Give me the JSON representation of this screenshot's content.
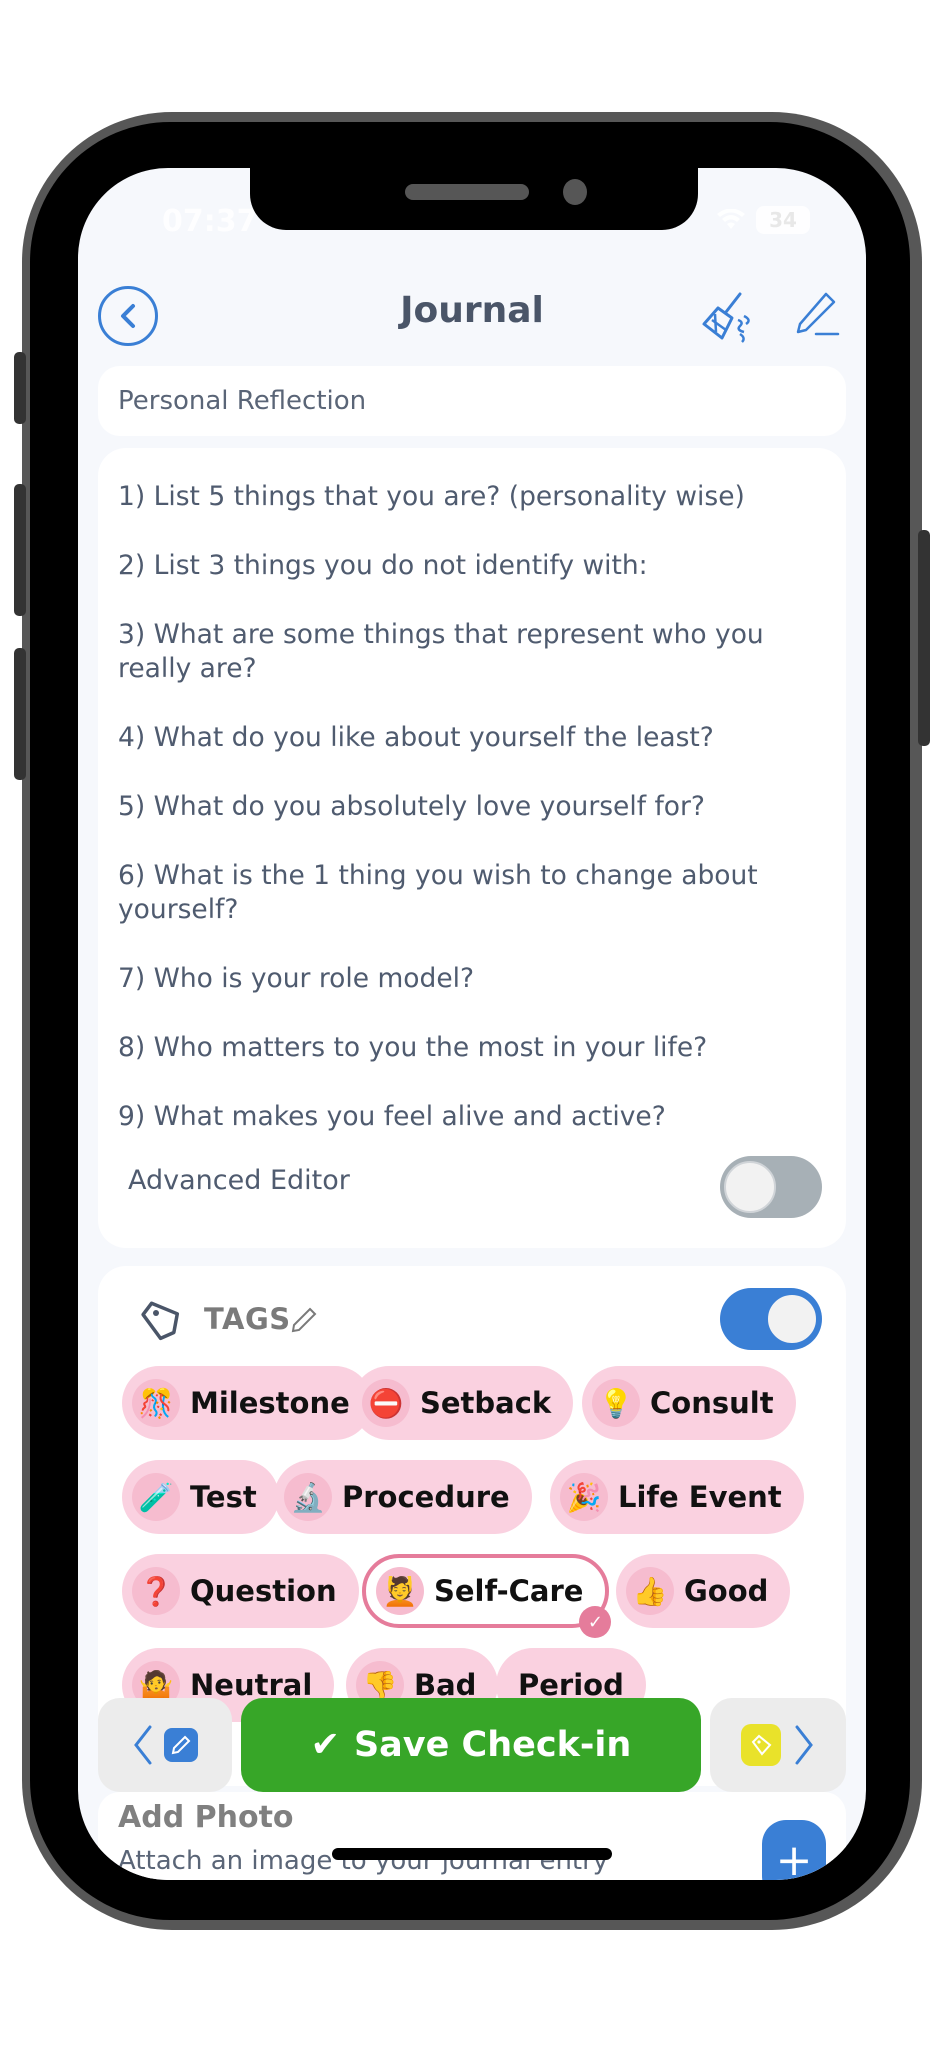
{
  "status_bar": {
    "time": "07:37",
    "battery": "34"
  },
  "header": {
    "title": "Journal"
  },
  "entry": {
    "title_value": "Personal Reflection"
  },
  "questions": [
    "1) List 5 things that you are? (personality wise)",
    "2) List 3 things you do not identify with:",
    "3) What are some things that represent who you really are?",
    "4) What do you like about yourself the least?",
    "5) What do you absolutely love yourself for?",
    "6) What is the 1 thing you wish to change about yourself?",
    "7) Who is your role model?",
    "8) Who matters to you the most in your life?",
    "9) What makes you feel alive and active?"
  ],
  "advanced_editor": {
    "label": "Advanced Editor",
    "enabled": false
  },
  "tags": {
    "label": "TAGS",
    "enabled": true,
    "items": [
      {
        "emoji": "🎊",
        "label": "Milestone",
        "selected": false
      },
      {
        "emoji": "⛔",
        "label": "Setback",
        "selected": false
      },
      {
        "emoji": "💡",
        "label": "Consult",
        "selected": false
      },
      {
        "emoji": "🧪",
        "label": "Test",
        "selected": false
      },
      {
        "emoji": "🔬",
        "label": "Procedure",
        "selected": false
      },
      {
        "emoji": "🎉",
        "label": "Life Event",
        "selected": false
      },
      {
        "emoji": "❓",
        "label": "Question",
        "selected": false
      },
      {
        "emoji": "💆",
        "label": "Self-Care",
        "selected": true
      },
      {
        "emoji": "👍",
        "label": "Good",
        "selected": false
      },
      {
        "emoji": "🤷",
        "label": "Neutral",
        "selected": false
      },
      {
        "emoji": "👎",
        "label": "Bad",
        "selected": false
      },
      {
        "emoji": "",
        "label": "Period",
        "selected": false
      }
    ]
  },
  "actions": {
    "save_label": "Save Check-in",
    "check_glyph": "✔"
  },
  "photo": {
    "title": "Add Photo",
    "subtitle": "Attach an image to your journal entry",
    "add_glyph": "+"
  },
  "colors": {
    "accent": "#3a7fd5",
    "save_green": "#37a628",
    "tag_pink": "#fad1e0",
    "selected_border": "#e57c9b",
    "tag_yellow": "#e9e22a"
  }
}
